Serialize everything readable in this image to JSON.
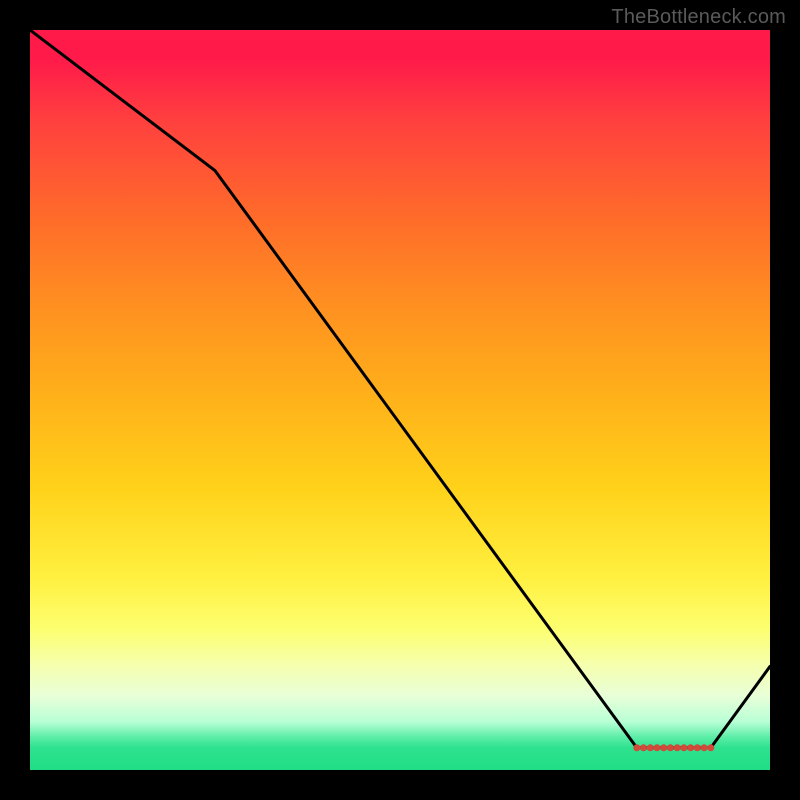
{
  "watermark": "TheBottleneck.com",
  "chart_data": {
    "type": "line",
    "title": "",
    "xlabel": "",
    "ylabel": "",
    "xlim": [
      0,
      100
    ],
    "ylim": [
      0,
      100
    ],
    "series": [
      {
        "name": "curve",
        "x": [
          0,
          25,
          82,
          88,
          92,
          100
        ],
        "values": [
          100,
          81,
          3,
          3,
          3,
          14
        ]
      }
    ],
    "plateau_dots": {
      "x_start": 82,
      "x_end": 92,
      "y": 3,
      "count": 12
    },
    "colors": {
      "line": "#000000",
      "dots": "#d24a3a",
      "gradient_top": "#ff1a4a",
      "gradient_bottom": "#20dd86"
    }
  }
}
